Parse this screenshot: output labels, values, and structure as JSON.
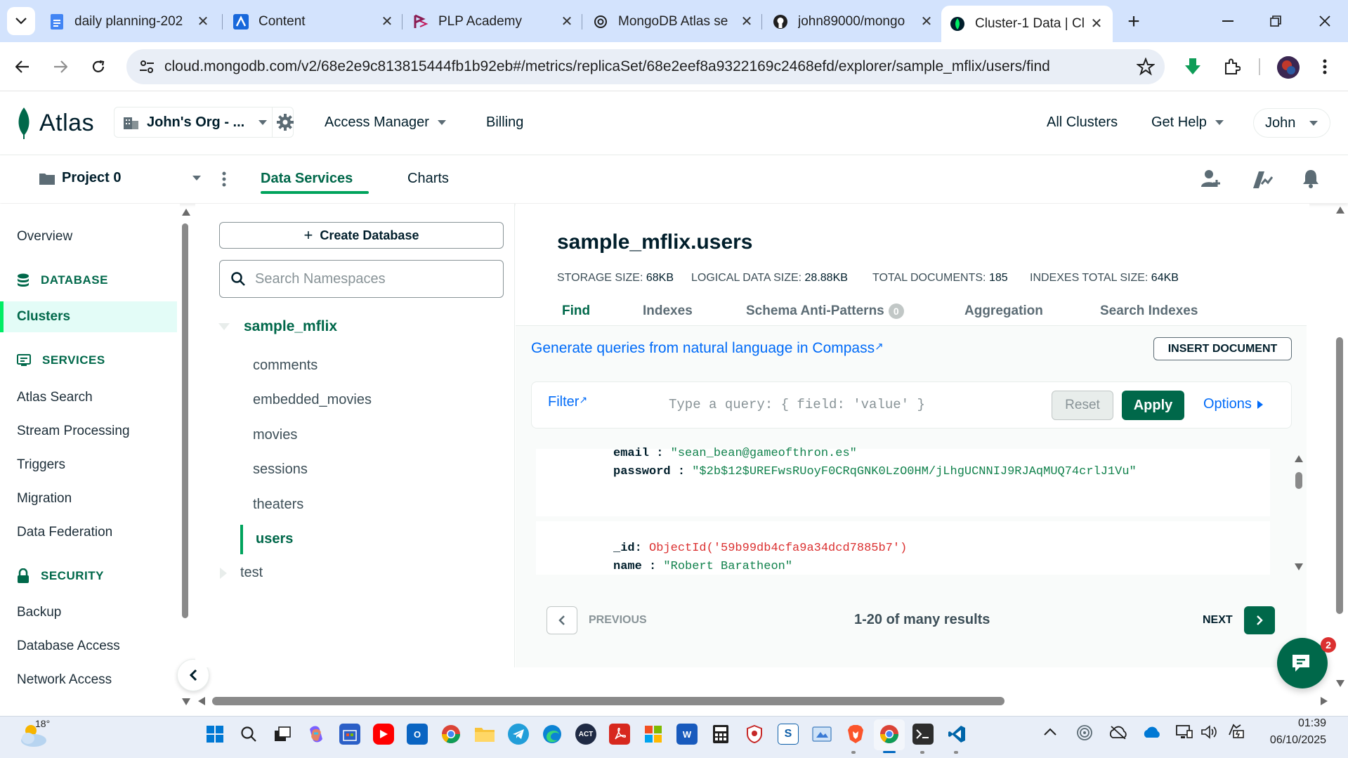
{
  "browser": {
    "tabs": [
      {
        "title": "daily planning-202",
        "icon": "docs-icon",
        "color": "#4285f4"
      },
      {
        "title": "Content",
        "icon": "atlassian-icon",
        "color": "#1868db"
      },
      {
        "title": "PLP Academy",
        "icon": "plp-icon",
        "color": "#8a1c53"
      },
      {
        "title": "MongoDB Atlas se",
        "icon": "openai-icon",
        "color": "#1f1f1f"
      },
      {
        "title": "john89000/mongo",
        "icon": "github-icon",
        "color": "#1f1f1f"
      },
      {
        "title": "Cluster-1 Data | Cl",
        "icon": "mongodb-leaf-icon",
        "color": "#00684a"
      }
    ],
    "url": "cloud.mongodb.com/v2/68e2e9c813815444fb1b92eb#/metrics/replicaSet/68e2eef8a9322169c2468efd/explorer/sample_mflix/users/find"
  },
  "atlas_header": {
    "logo": "Atlas",
    "org": "John's Org - ...",
    "access_manager": "Access Manager",
    "billing": "Billing",
    "all_clusters": "All Clusters",
    "get_help": "Get Help",
    "user": "John"
  },
  "project_bar": {
    "project": "Project 0",
    "tabs": [
      "Data Services",
      "Charts"
    ],
    "active_tab": "Data Services"
  },
  "leftnav": {
    "overview": "Overview",
    "database_header": "DATABASE",
    "clusters": "Clusters",
    "services_header": "SERVICES",
    "services": [
      "Atlas Search",
      "Stream Processing",
      "Triggers",
      "Migration",
      "Data Federation"
    ],
    "security_header": "SECURITY",
    "security": [
      "Backup",
      "Database Access",
      "Network Access"
    ]
  },
  "namespaces": {
    "create_label": "Create Database",
    "search_placeholder": "Search Namespaces",
    "database": "sample_mflix",
    "collections": [
      "comments",
      "embedded_movies",
      "movies",
      "sessions",
      "theaters",
      "users"
    ],
    "active_collection": "users",
    "other_db": "test"
  },
  "collection": {
    "title": "sample_mflix.users",
    "stats": [
      {
        "label": "STORAGE SIZE:",
        "value": "68KB"
      },
      {
        "label": "LOGICAL DATA SIZE:",
        "value": "28.88KB"
      },
      {
        "label": "TOTAL DOCUMENTS:",
        "value": "185"
      },
      {
        "label": "INDEXES TOTAL SIZE:",
        "value": "64KB"
      }
    ],
    "tabs": [
      "Find",
      "Indexes",
      "Schema Anti-Patterns",
      "Aggregation",
      "Search Indexes"
    ],
    "schema_badge": "0",
    "active_tab": "Find"
  },
  "find": {
    "generate_link": "Generate queries from natural language in Compass",
    "insert_button": "INSERT DOCUMENT",
    "filter_label": "Filter",
    "query_placeholder": "Type a query: { field: 'value' }",
    "reset": "Reset",
    "apply": "Apply",
    "options": "Options"
  },
  "documents": [
    {
      "fields": [
        {
          "key": "email",
          "value": "\"sean_bean@gameofthron.es\""
        },
        {
          "key": "password",
          "value": "\"$2b$12$UREFwsRUoyF0CRqGNK0LzO0HM/jLhgUCNNIJ9RJAqMUQ74crlJ1Vu\""
        }
      ]
    },
    {
      "fields": [
        {
          "key": "_id",
          "value": "ObjectId('59b99db4cfa9a34dcd7885b7')"
        },
        {
          "key": "name",
          "value": "\"Robert Baratheon\""
        }
      ]
    }
  ],
  "pager": {
    "previous": "PREVIOUS",
    "summary": "1-20 of many results",
    "next": "NEXT"
  },
  "chat": {
    "badge": "2"
  },
  "taskbar": {
    "weather": "18°",
    "time": "01:39",
    "date": "06/10/2025"
  },
  "colors": {
    "brand_green": "#00684a",
    "accent_green": "#00ed64",
    "link_blue": "#016bf8",
    "oid_red": "#db3030"
  }
}
